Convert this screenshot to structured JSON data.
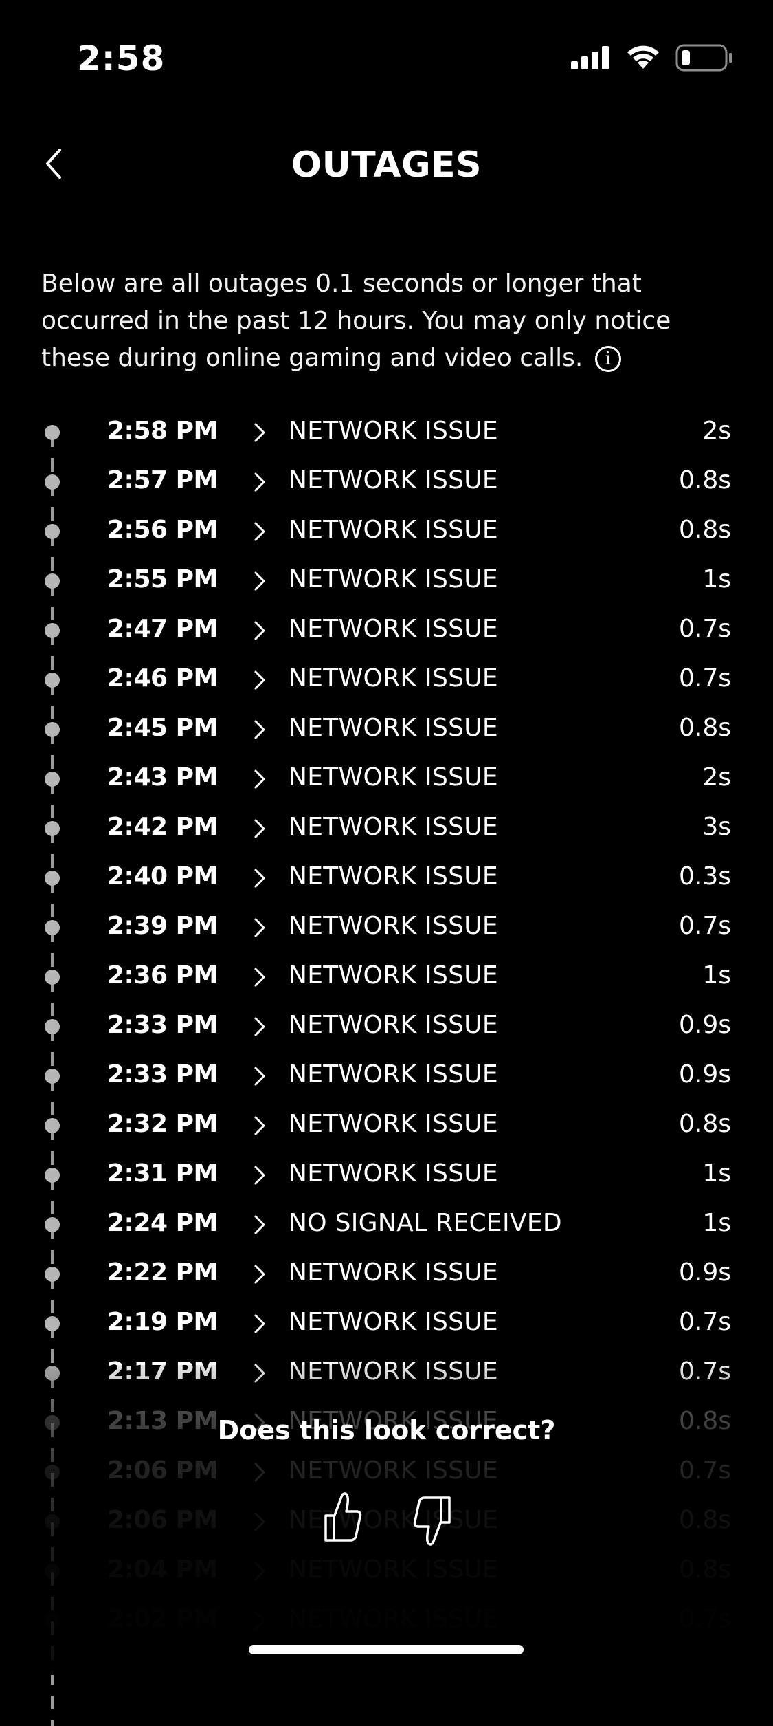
{
  "status_bar": {
    "time": "2:58",
    "icons": [
      "cellular-signal-icon",
      "wifi-icon",
      "battery-icon"
    ]
  },
  "header": {
    "back_icon": "chevron-left-icon",
    "title": "OUTAGES"
  },
  "description": {
    "text": "Below are all outages 0.1 seconds or longer that occurred in the past 12 hours. You may only notice these during online gaming and video calls.",
    "info_icon": "i"
  },
  "outages": [
    {
      "time": "2:58 PM",
      "status": "NETWORK ISSUE",
      "duration": "2s"
    },
    {
      "time": "2:57 PM",
      "status": "NETWORK ISSUE",
      "duration": "0.8s"
    },
    {
      "time": "2:56 PM",
      "status": "NETWORK ISSUE",
      "duration": "0.8s"
    },
    {
      "time": "2:55 PM",
      "status": "NETWORK ISSUE",
      "duration": "1s"
    },
    {
      "time": "2:47 PM",
      "status": "NETWORK ISSUE",
      "duration": "0.7s"
    },
    {
      "time": "2:46 PM",
      "status": "NETWORK ISSUE",
      "duration": "0.7s"
    },
    {
      "time": "2:45 PM",
      "status": "NETWORK ISSUE",
      "duration": "0.8s"
    },
    {
      "time": "2:43 PM",
      "status": "NETWORK ISSUE",
      "duration": "2s"
    },
    {
      "time": "2:42 PM",
      "status": "NETWORK ISSUE",
      "duration": "3s"
    },
    {
      "time": "2:40 PM",
      "status": "NETWORK ISSUE",
      "duration": "0.3s"
    },
    {
      "time": "2:39 PM",
      "status": "NETWORK ISSUE",
      "duration": "0.7s"
    },
    {
      "time": "2:36 PM",
      "status": "NETWORK ISSUE",
      "duration": "1s"
    },
    {
      "time": "2:33 PM",
      "status": "NETWORK ISSUE",
      "duration": "0.9s"
    },
    {
      "time": "2:33 PM",
      "status": "NETWORK ISSUE",
      "duration": "0.9s"
    },
    {
      "time": "2:32 PM",
      "status": "NETWORK ISSUE",
      "duration": "0.8s"
    },
    {
      "time": "2:31 PM",
      "status": "NETWORK ISSUE",
      "duration": "1s"
    },
    {
      "time": "2:24 PM",
      "status": "NO SIGNAL RECEIVED",
      "duration": "1s"
    },
    {
      "time": "2:22 PM",
      "status": "NETWORK ISSUE",
      "duration": "0.9s"
    },
    {
      "time": "2:19 PM",
      "status": "NETWORK ISSUE",
      "duration": "0.7s"
    },
    {
      "time": "2:17 PM",
      "status": "NETWORK ISSUE",
      "duration": "0.7s"
    },
    {
      "time": "2:13 PM",
      "status": "NETWORK ISSUE",
      "duration": "0.8s"
    },
    {
      "time": "2:06 PM",
      "status": "NETWORK ISSUE",
      "duration": "0.7s"
    },
    {
      "time": "2:06 PM",
      "status": "NETWORK ISSUE",
      "duration": "0.8s"
    },
    {
      "time": "2:04 PM",
      "status": "NETWORK ISSUE",
      "duration": "0.8s"
    },
    {
      "time": "2:02 PM",
      "status": "NETWORK ISSUE",
      "duration": "0.7s"
    }
  ],
  "feedback": {
    "question": "Does this look correct?",
    "positive_icon": "thumbs-up-icon",
    "negative_icon": "thumbs-down-icon"
  },
  "colors": {
    "background": "#000000",
    "text": "#ffffff",
    "timeline": "#9a9a9a",
    "dot": "#b5b5b5"
  }
}
